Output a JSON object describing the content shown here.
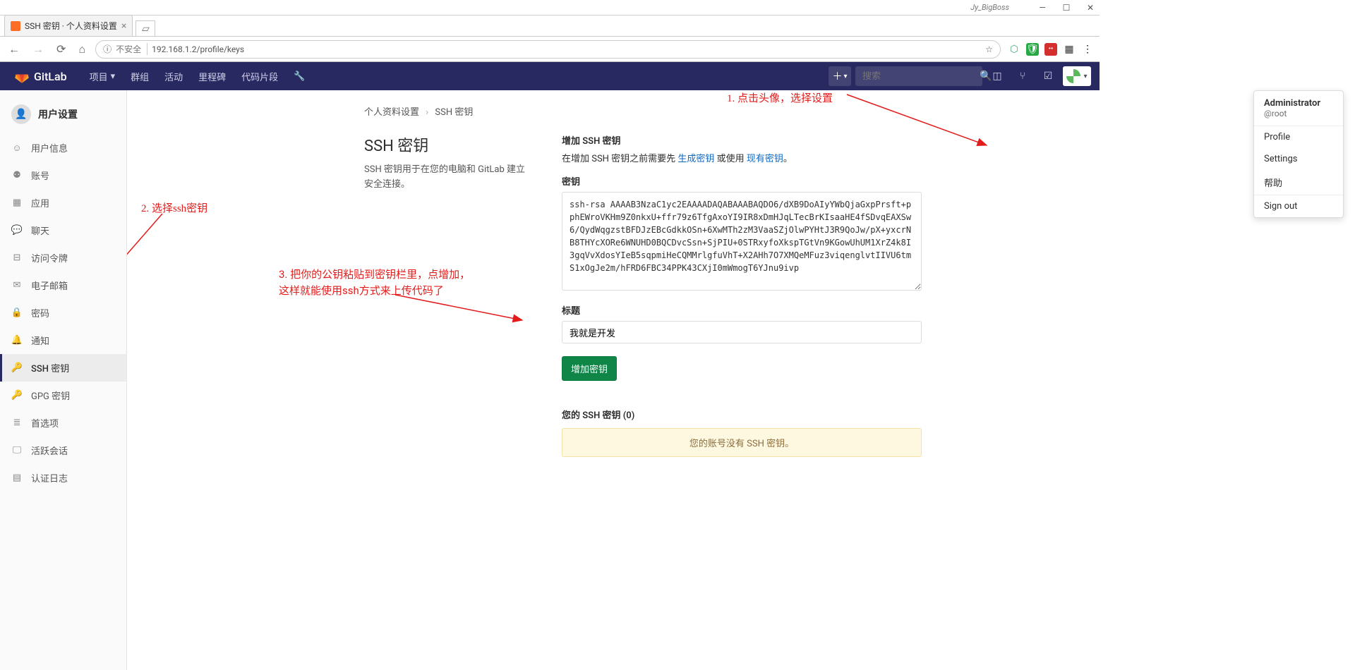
{
  "browser": {
    "titlebar_user": "Jy_BigBoss",
    "tab_title": "SSH 密钥 · 个人资料设置",
    "insecure_label": "不安全",
    "url": "192.168.1.2/profile/keys"
  },
  "topbar": {
    "brand": "GitLab",
    "nav": [
      "项目",
      "群组",
      "活动",
      "里程碑",
      "代码片段"
    ],
    "search_placeholder": "搜索"
  },
  "dropdown": {
    "name": "Administrator",
    "username": "@root",
    "items": [
      "Profile",
      "Settings",
      "帮助",
      "Sign out"
    ]
  },
  "sidebar": {
    "title": "用户设置",
    "items": [
      {
        "icon": "user",
        "label": "用户信息"
      },
      {
        "icon": "users",
        "label": "账号"
      },
      {
        "icon": "apps",
        "label": "应用"
      },
      {
        "icon": "chat",
        "label": "聊天"
      },
      {
        "icon": "token",
        "label": "访问令牌"
      },
      {
        "icon": "mail",
        "label": "电子邮箱"
      },
      {
        "icon": "lock",
        "label": "密码"
      },
      {
        "icon": "bell",
        "label": "通知"
      },
      {
        "icon": "key",
        "label": "SSH 密钥",
        "active": true
      },
      {
        "icon": "key",
        "label": "GPG 密钥"
      },
      {
        "icon": "pref",
        "label": "首选项"
      },
      {
        "icon": "session",
        "label": "活跃会话"
      },
      {
        "icon": "log",
        "label": "认证日志"
      }
    ]
  },
  "breadcrumb": {
    "root": "个人资料设置",
    "current": "SSH 密钥"
  },
  "left_panel": {
    "title": "SSH 密钥",
    "desc": "SSH 密钥用于在您的电脑和 GitLab 建立安全连接。"
  },
  "form": {
    "heading": "增加 SSH 密钥",
    "hint_prefix": "在增加 SSH 密钥之前需要先 ",
    "hint_link1": "生成密钥",
    "hint_mid": " 或使用 ",
    "hint_link2": "现有密钥",
    "hint_suffix": "。",
    "key_label": "密钥",
    "key_value": "ssh-rsa AAAAB3NzaC1yc2EAAAADAQABAAABAQDO6/dXB9DoAIyYWbQjaGxpPrsft+pphEWroVKHm9Z0nkxU+ffr79z6TfgAxoYI9IR8xDmHJqLTecBrKIsaaHE4fSDvqEAXSw6/QydWqgzstBFDJzEBcGdkkOSn+6XwMTh2zM3VaaSZjOlwPYHtJ3R9QoJw/pX+yxcrNB8THYcXORe6WNUHD0BQCDvcSsn+SjPIU+0STRxyfoXkspTGtVn9KGowUhUM1XrZ4k8I3gqVvXdosYIeB5sqpmiHeCQMMrlgfuVhT+X2AHh7O7XMQeMFuz3viqenglvtIIVU6tmS1xOgJe2m/hFRD6FBC34PPK43CXjI0mWmogT6YJnu9ivp",
    "title_label": "标题",
    "title_value": "我就是开发",
    "submit": "增加密钥"
  },
  "your_keys": {
    "title": "您的 SSH 密钥 (0)",
    "empty": "您的账号没有 SSH 密钥。"
  },
  "annotations": {
    "a1": "1. 点击头像，选择设置",
    "a2": "2. 选择ssh密钥",
    "a3_l1": "3. 把你的公钥粘贴到密钥栏里，点增加，",
    "a3_l2": "这样就能使用ssh方式来上传代码了"
  }
}
